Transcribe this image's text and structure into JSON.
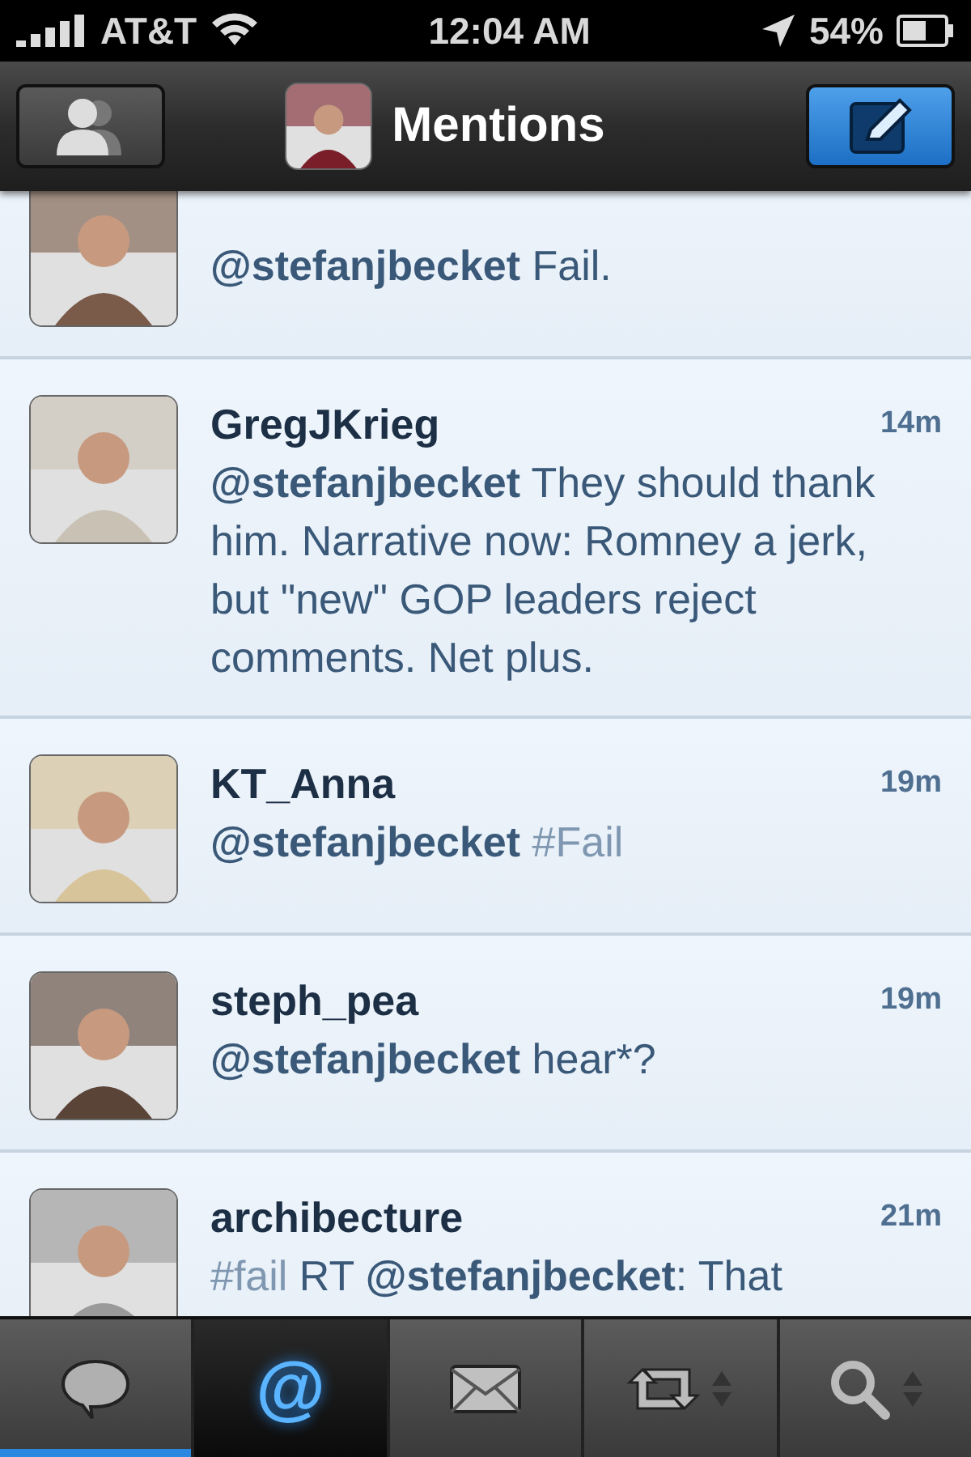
{
  "status_bar": {
    "carrier": "AT&T",
    "time": "12:04 AM",
    "battery": "54%"
  },
  "nav": {
    "title": "Mentions"
  },
  "tweets": [
    {
      "body": [
        {
          "kind": "mention",
          "text": "@stefanjbecket"
        },
        {
          "kind": "text",
          "text": " Fail."
        }
      ]
    },
    {
      "time": "14m",
      "name": "GregJKrieg",
      "body": [
        {
          "kind": "mention",
          "text": "@stefanjbecket"
        },
        {
          "kind": "text",
          "text": " They should thank him. Narrative now: Romney a jerk, but \"new\" GOP leaders reject comments. Net plus."
        }
      ]
    },
    {
      "time": "19m",
      "name": "KT_Anna",
      "body": [
        {
          "kind": "mention",
          "text": "@stefanjbecket "
        },
        {
          "kind": "hashtag",
          "text": "#Fail"
        }
      ]
    },
    {
      "time": "19m",
      "name": "steph_pea",
      "body": [
        {
          "kind": "mention",
          "text": "@stefanjbecket"
        },
        {
          "kind": "text",
          "text": " hear*?"
        }
      ]
    },
    {
      "time": "21m",
      "name": "archibecture",
      "body": [
        {
          "kind": "hashtag",
          "text": "#fail"
        },
        {
          "kind": "text",
          "text": " RT "
        },
        {
          "kind": "mention",
          "text": "@stefanjbecket"
        },
        {
          "kind": "text",
          "text": ": That"
        }
      ]
    }
  ],
  "tabs": [
    {
      "selected": false,
      "unread": true,
      "menu": false
    },
    {
      "selected": true,
      "unread": false,
      "menu": false,
      "label": "@"
    },
    {
      "selected": false,
      "unread": false,
      "menu": false
    },
    {
      "selected": false,
      "unread": false,
      "menu": true
    },
    {
      "selected": false,
      "unread": false,
      "menu": true
    }
  ]
}
